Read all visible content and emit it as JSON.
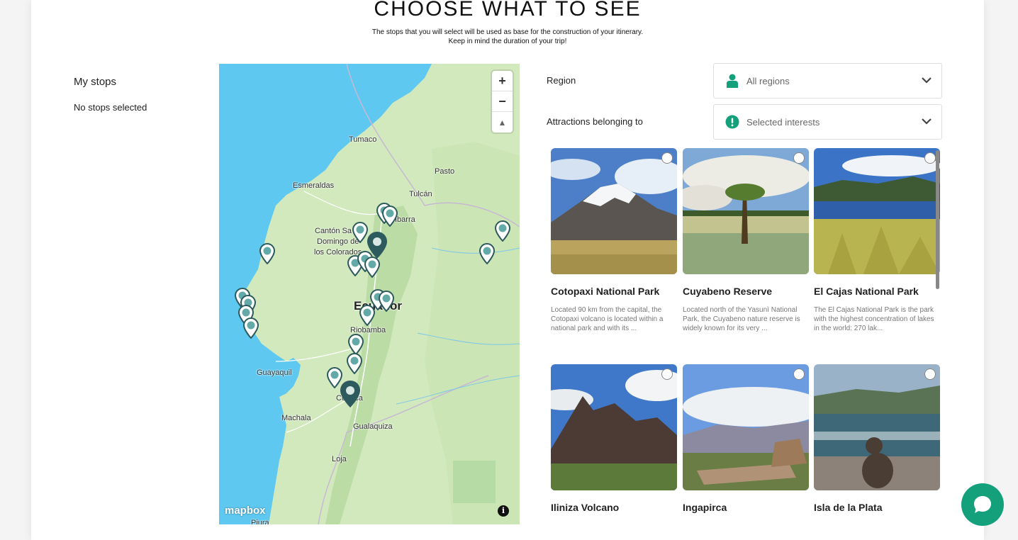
{
  "header": {
    "title": "CHOOSE WHAT TO SEE",
    "subtitle_line1": "The stops that you will select will be used as base for the construction of your itinerary.",
    "subtitle_line2": "Keep in mind the duration of your trip!"
  },
  "my_stops": {
    "title": "My stops",
    "empty_text": "No stops selected"
  },
  "map": {
    "zoom_in": "+",
    "zoom_out": "−",
    "compass": "▲",
    "attribution_logo": "mapbox",
    "info": "i",
    "labels": {
      "tumaco": "Tumaco",
      "pasto": "Pasto",
      "esmeraldas": "Esmeraldas",
      "tulcan": "Tulcán",
      "ibarra": "Ibarra",
      "santo_domingo": "Cantón Santo Domingo de los Colorados",
      "santo_domingo_l1": "Cantón Sa",
      "santo_domingo_l2": "Domingo de",
      "santo_domingo_l3": "los Colorados",
      "ecuador": "Ecuador",
      "riobamba": "Riobamba",
      "guayaquil": "Guayaquil",
      "cuenca": "Cuenca",
      "machala": "Machala",
      "gualaquiza": "Gualaquiza",
      "loja": "Loja",
      "piura": "Piura"
    }
  },
  "filters": {
    "region_label": "Region",
    "region_value": "All regions",
    "attractions_label": "Attractions belonging to",
    "attractions_value": "Selected interests",
    "accent_color": "#13a07b"
  },
  "attractions": [
    {
      "name": "Cotopaxi National Park",
      "description": "Located 90 km from the capital, the Cotopaxi volcano is located within a national park and with its ..."
    },
    {
      "name": "Cuyabeno Reserve",
      "description": "Located north of the Yasunì National Park, the Cuyabeno nature reserve is widely known for its very ..."
    },
    {
      "name": "El Cajas National Park",
      "description": "The El Cajas National Park is the park with the highest concentration of lakes in the world: 270 lak..."
    },
    {
      "name": "Iliniza Volcano",
      "description": ""
    },
    {
      "name": "Ingapirca",
      "description": ""
    },
    {
      "name": "Isla de la Plata",
      "description": ""
    }
  ],
  "chat": {
    "icon": "chat-bubble-icon"
  }
}
